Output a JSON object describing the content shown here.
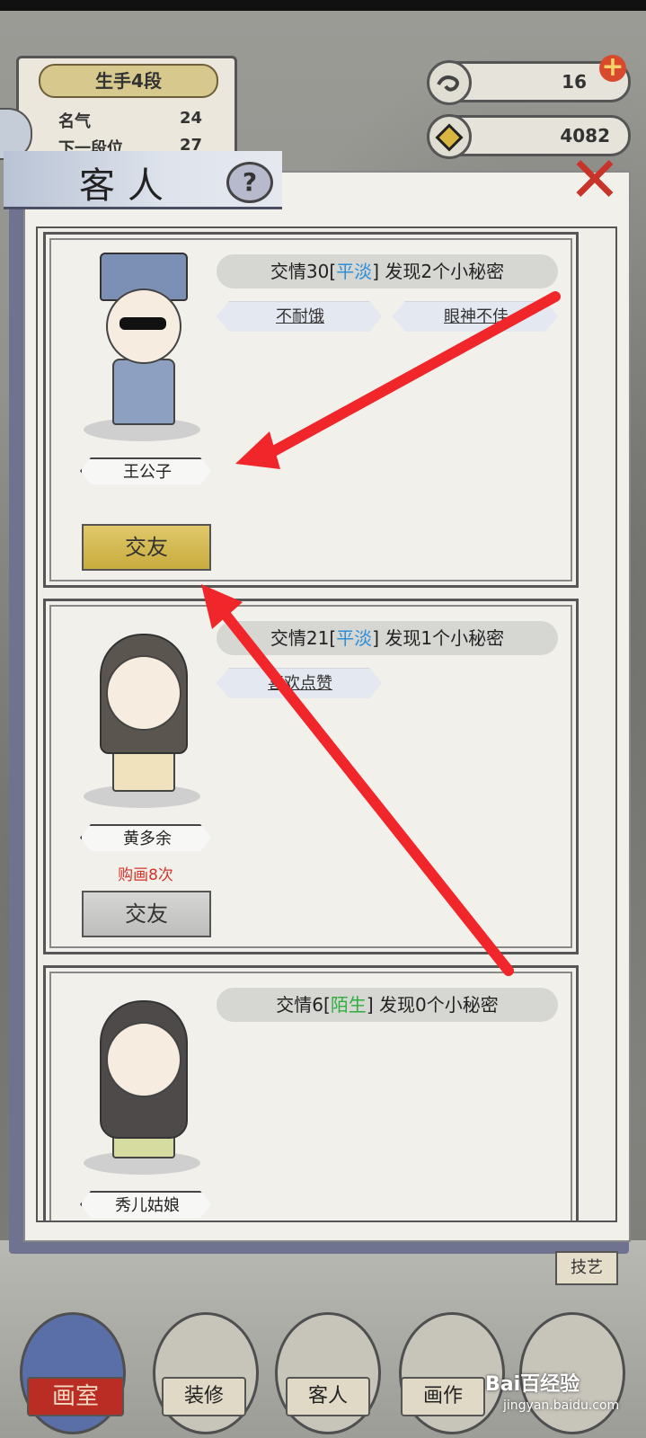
{
  "rank": {
    "title": "生手4段",
    "fame_label": "名气",
    "fame_value": "24",
    "next_label": "下一段位",
    "next_value": "27"
  },
  "currency": {
    "primary_value": "16",
    "coins_value": "4082"
  },
  "panel": {
    "title": "客人",
    "help_label": "?"
  },
  "guests": [
    {
      "name": "王公子",
      "intimacy_prefix": "交情30[",
      "level": "平淡",
      "intimacy_suffix": "] 发现2个小秘密",
      "secrets": [
        "不耐饿",
        "眼神不佳"
      ],
      "buy_count": "",
      "button_label": "交友",
      "button_state": "active"
    },
    {
      "name": "黄多余",
      "intimacy_prefix": "交情21[",
      "level": "平淡",
      "intimacy_suffix": "] 发现1个小秘密",
      "secrets": [
        "喜欢点赞"
      ],
      "buy_count": "购画8次",
      "button_label": "交友",
      "button_state": "inactive"
    },
    {
      "name": "秀儿姑娘",
      "intimacy_prefix": "交情6[",
      "level": "陌生",
      "intimacy_suffix": "] 发现0个小秘密",
      "secrets": [],
      "buy_count": "",
      "button_label": "",
      "button_state": ""
    }
  ],
  "nav": {
    "studio": "画室",
    "decorate": "装修",
    "guests": "客人",
    "paintings": "画作",
    "skills": "技艺"
  },
  "watermark": {
    "brand": "Bai百经验",
    "url": "jingyan.baidu.com"
  },
  "colors": {
    "level_plain": "#2f8fd6",
    "level_stranger": "#2eae3e",
    "buy_count": "#d6332a",
    "arrow": "#f0262a"
  }
}
